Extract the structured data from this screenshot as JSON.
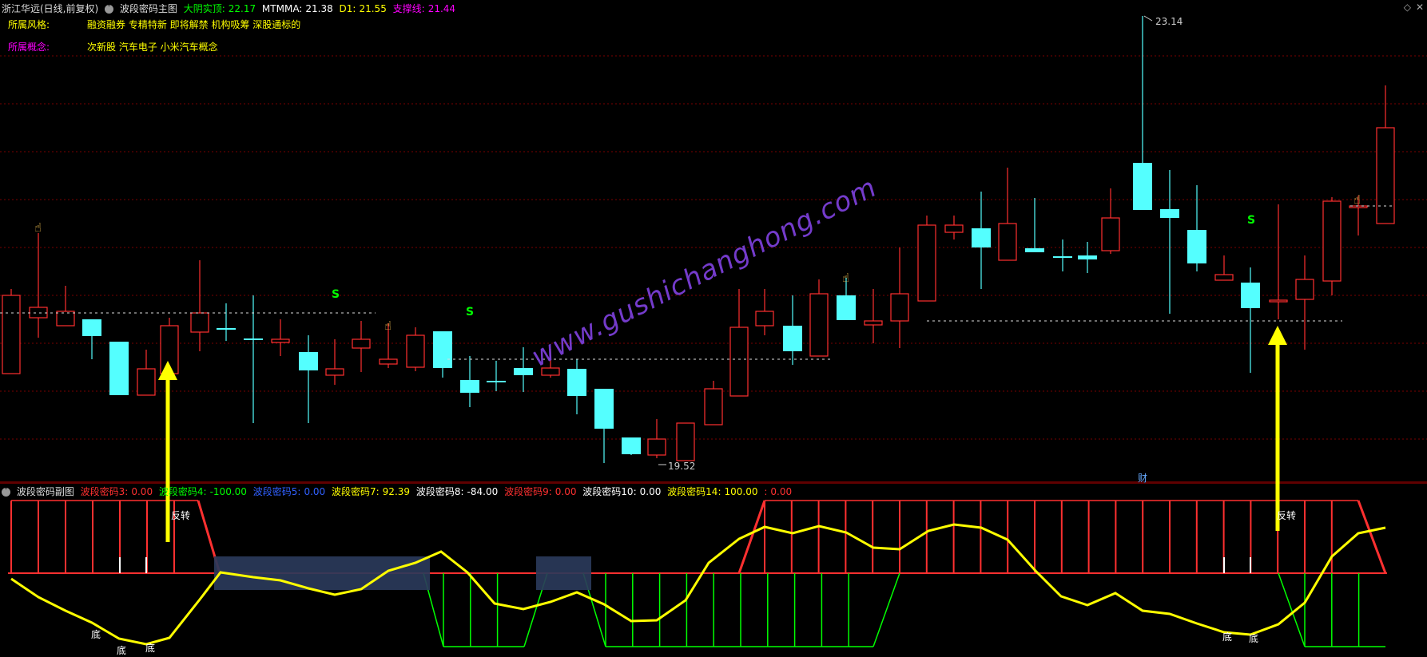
{
  "header": {
    "stock_name": "浙江华远(日线,前复权)",
    "indicator_name": "波段密码主图",
    "values": [
      {
        "label": "大阴实顶:",
        "value": "22.17",
        "color": "#00ff00"
      },
      {
        "label": "MTMMA:",
        "value": "21.38",
        "color": "#ffffff"
      },
      {
        "label": "D1:",
        "value": "21.55",
        "color": "#ffff00"
      },
      {
        "label": "支撑线:",
        "value": "21.44",
        "color": "#ff00ff"
      }
    ]
  },
  "info": {
    "style_label": "所属风格:",
    "style_value": "融资融券 专精特新 即将解禁 机构吸筹 深股通标的",
    "concept_label": "所属概念:",
    "concept_value": "次新股 汽车电子 小米汽车概念"
  },
  "annotations": {
    "high_price": "23.14",
    "low_price": "19.52",
    "finance_marker": "财",
    "s_marks": [
      "S",
      "S",
      "S"
    ],
    "watermark": "www.gushichanghong.com"
  },
  "sub_header": {
    "indicator_name": "波段密码副图",
    "values": [
      {
        "label": "波段密码3:",
        "value": "0.00",
        "color": "#ff3030"
      },
      {
        "label": "波段密码4:",
        "value": "-100.00",
        "color": "#00ff00"
      },
      {
        "label": "波段密码5:",
        "value": "0.00",
        "color": "#3060ff"
      },
      {
        "label": "波段密码7:",
        "value": "92.39",
        "color": "#ffff00"
      },
      {
        "label": "波段密码8:",
        "value": "-84.00",
        "color": "#ffffff"
      },
      {
        "label": "波段密码9:",
        "value": "0.00",
        "color": "#ff3030"
      },
      {
        "label": "波段密码10:",
        "value": "0.00",
        "color": "#ffffff"
      },
      {
        "label": "波段密码14:",
        "value": "100.00",
        "color": "#ffff00"
      },
      {
        "label": ":",
        "value": "0.00",
        "color": "#ff3030"
      }
    ]
  },
  "sub_labels": {
    "reverse_left": "反转",
    "reverse_right": "反转",
    "bottom_1": "底",
    "bottom_2": "底",
    "bottom_3": "底",
    "bottom_4": "底",
    "bottom_5": "底"
  },
  "colors": {
    "up": "#ff3030",
    "down": "#54ffff",
    "grid": "#7a0000",
    "yellow": "#ffff00",
    "green": "#00ff00",
    "panel": "#2a3a5a"
  }
}
